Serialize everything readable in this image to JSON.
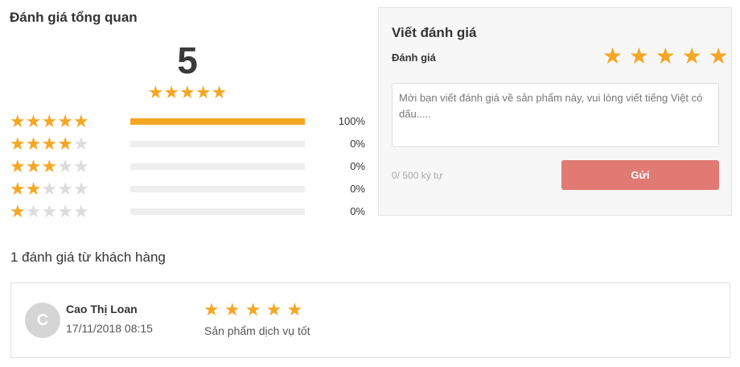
{
  "overview": {
    "title": "Đánh giá tổng quan",
    "average_score": "5",
    "average_stars": 5,
    "breakdown": [
      {
        "stars": 5,
        "percent_label": "100%",
        "fill": 1.0
      },
      {
        "stars": 4,
        "percent_label": "0%",
        "fill": 0
      },
      {
        "stars": 3,
        "percent_label": "0%",
        "fill": 0
      },
      {
        "stars": 2,
        "percent_label": "0%",
        "fill": 0
      },
      {
        "stars": 1,
        "percent_label": "0%",
        "fill": 0
      }
    ]
  },
  "reviews": {
    "count_label": "1 đánh giá từ khách hàng",
    "items": [
      {
        "avatar_letter": "C",
        "name": "Cao Thị Loan",
        "date": "17/11/2018 08:15",
        "stars": 5,
        "text": "Sản phẩm dịch vụ tốt"
      }
    ]
  },
  "write_review": {
    "title": "Viết đánh giá",
    "rating_label": "Đánh giá",
    "rating_stars": 5,
    "placeholder": "Mời bạn viết đánh giá về sản phẩm này, vui lòng viết tiếng Việt có dấu.....",
    "char_count": "0/ 500 ký tự",
    "submit_label": "Gửi"
  },
  "colors": {
    "star_active": "#f5a623",
    "star_inactive": "#dcdcdc",
    "submit_button": "#e07a72",
    "bar_fill": "#f5a623"
  }
}
